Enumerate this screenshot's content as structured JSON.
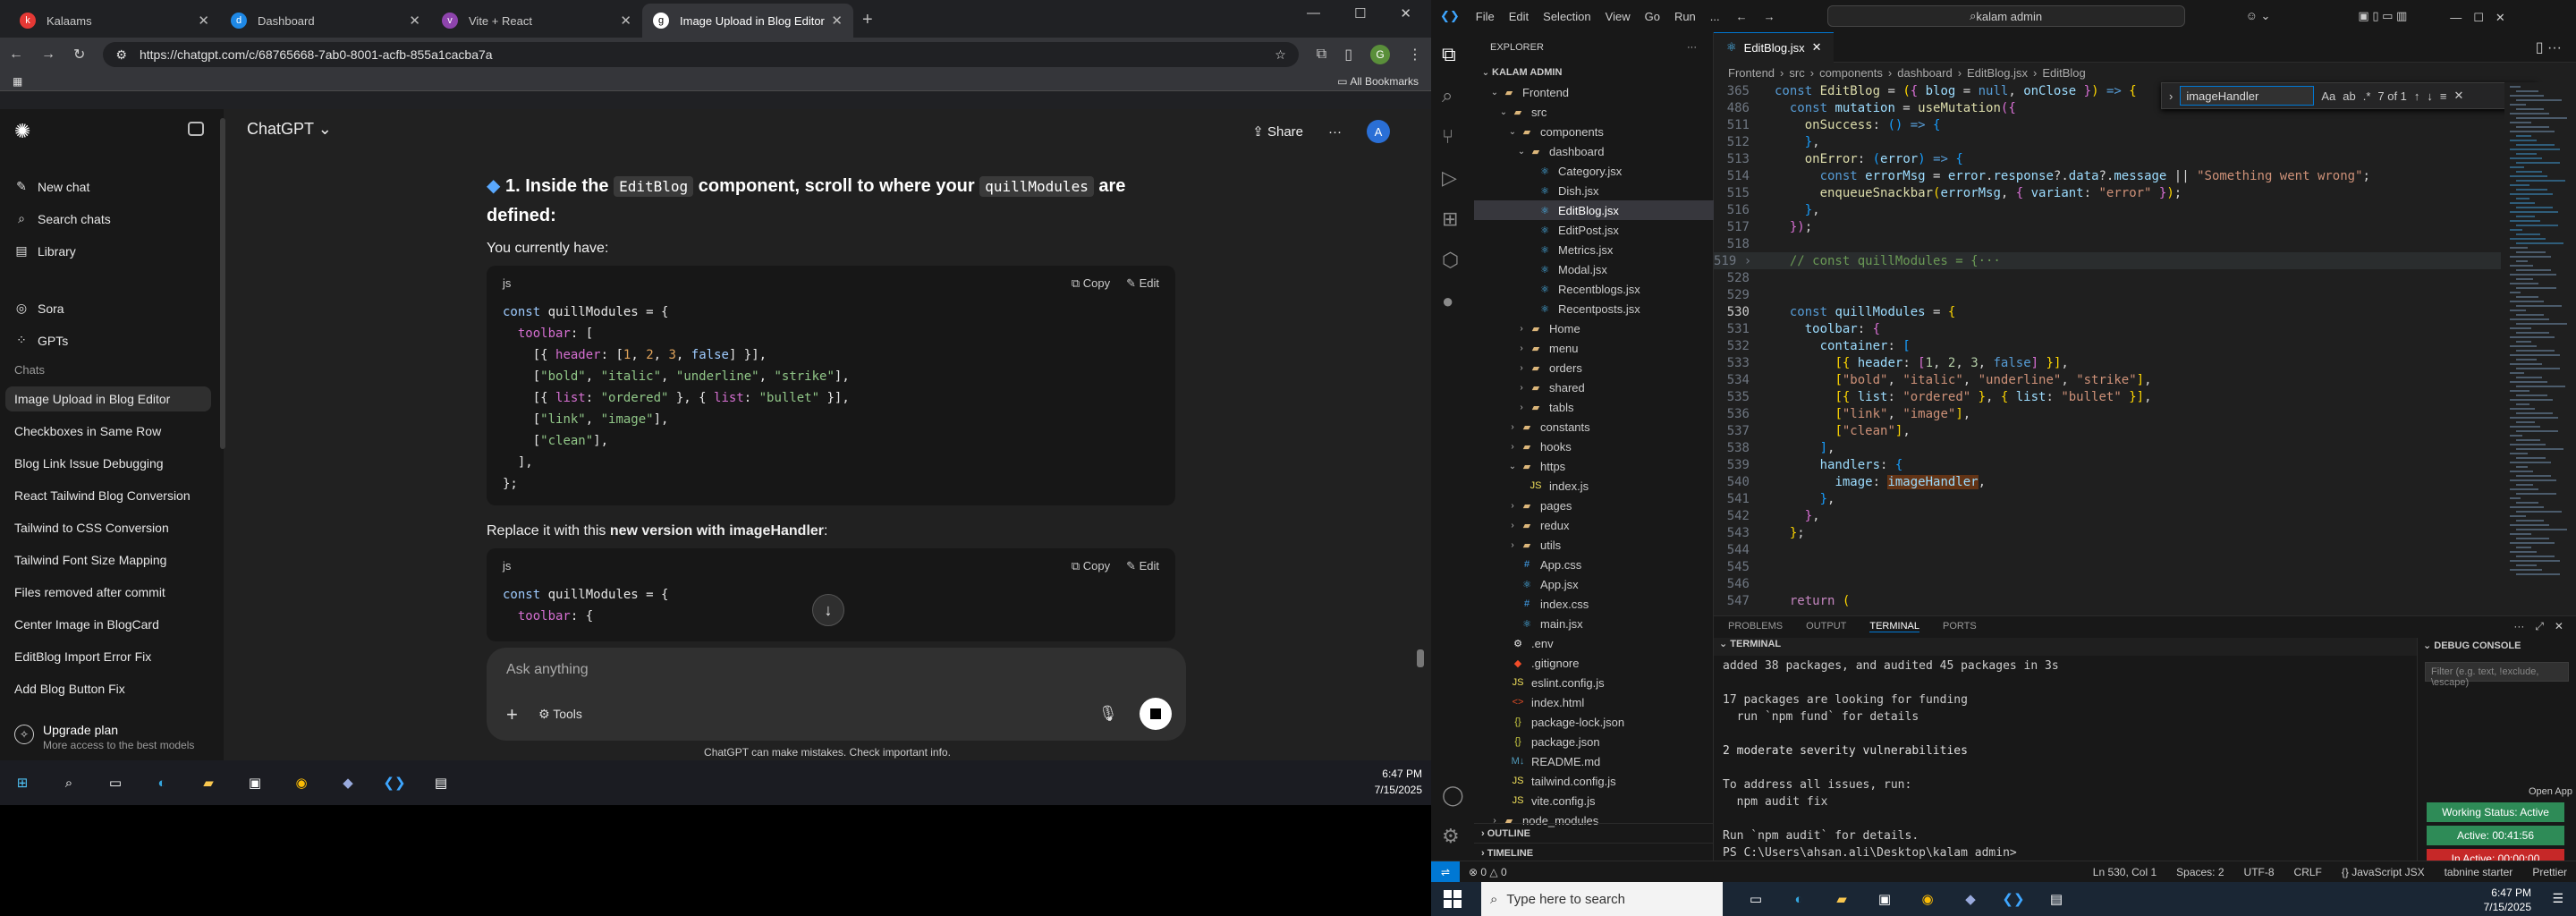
{
  "chrome": {
    "tabs": [
      {
        "label": "Kalaams",
        "icon": "k",
        "color": "#e53935"
      },
      {
        "label": "Dashboard",
        "icon": "d",
        "color": "#1e88e5"
      },
      {
        "label": "Vite + React",
        "icon": "v",
        "color": "#8e44ad"
      },
      {
        "label": "Image Upload in Blog Editor",
        "icon": "g",
        "color": "#ffffff"
      }
    ],
    "url": "https://chatgpt.com/c/68765668-7ab0-8001-acfb-855a1cacba7a",
    "bookmarks_label": "All Bookmarks",
    "profile_initial": "G"
  },
  "chatgpt": {
    "model": "ChatGPT",
    "share_label": "Share",
    "user_initial": "A",
    "sidebar": {
      "top_items": [
        {
          "label": "New chat",
          "icon": "edit-icon"
        },
        {
          "label": "Search chats",
          "icon": "search-icon"
        },
        {
          "label": "Library",
          "icon": "library-icon"
        }
      ],
      "mid_items": [
        {
          "label": "Sora",
          "icon": "sora-icon"
        },
        {
          "label": "GPTs",
          "icon": "gpts-icon"
        }
      ],
      "chats_heading": "Chats",
      "chats": [
        "Image Upload in Blog Editor",
        "Checkboxes in Same Row",
        "Blog Link Issue Debugging",
        "React Tailwind Blog Conversion",
        "Tailwind to CSS Conversion",
        "Tailwind Font Size Mapping",
        "Files removed after commit",
        "Center Image in BlogCard",
        "EditBlog Import Error Fix",
        "Add Blog Button Fix"
      ],
      "upgrade_title": "Upgrade plan",
      "upgrade_sub": "More access to the best models"
    },
    "message": {
      "step_prefix": "1. Inside the",
      "step_code1": "EditBlog",
      "step_mid": "component, scroll to where your",
      "step_code2": "quillModules",
      "step_suffix": "are defined:",
      "p1": "You currently have:",
      "p2_plain": "Replace it with this",
      "p2_bold": "new version with imageHandler",
      "p2_end": ":",
      "code_lang": "js",
      "copy_label": "Copy",
      "edit_label": "Edit"
    },
    "composer_placeholder": "Ask anything",
    "tools_label": "Tools",
    "disclaimer": "ChatGPT can make mistakes. Check important info."
  },
  "taskbar_left": {
    "time": "6:47 PM",
    "date": "7/15/2025"
  },
  "vscode": {
    "menu": [
      "File",
      "Edit",
      "Selection",
      "View",
      "Go",
      "Run",
      "..."
    ],
    "search": "kalam admin",
    "explorer_title": "EXPLORER",
    "root": "KALAM ADMIN",
    "tab": "EditBlog.jsx",
    "breadcrumb": [
      "Frontend",
      "src",
      "components",
      "dashboard",
      "EditBlog.jsx",
      "EditBlog"
    ],
    "find_text": "imageHandler",
    "find_count": "7 of 1",
    "tree": [
      {
        "d": 1,
        "t": "Frontend",
        "k": "folder",
        "o": "open"
      },
      {
        "d": 2,
        "t": "src",
        "k": "folder",
        "o": "open"
      },
      {
        "d": 3,
        "t": "components",
        "k": "folder",
        "o": "open"
      },
      {
        "d": 4,
        "t": "dashboard",
        "k": "folder",
        "o": "open"
      },
      {
        "d": 5,
        "t": "Category.jsx",
        "k": "jsx"
      },
      {
        "d": 5,
        "t": "Dish.jsx",
        "k": "jsx"
      },
      {
        "d": 5,
        "t": "EditBlog.jsx",
        "k": "jsx",
        "sel": true
      },
      {
        "d": 5,
        "t": "EditPost.jsx",
        "k": "jsx"
      },
      {
        "d": 5,
        "t": "Metrics.jsx",
        "k": "jsx"
      },
      {
        "d": 5,
        "t": "Modal.jsx",
        "k": "jsx"
      },
      {
        "d": 5,
        "t": "Recentblogs.jsx",
        "k": "jsx"
      },
      {
        "d": 5,
        "t": "Recentposts.jsx",
        "k": "jsx"
      },
      {
        "d": 4,
        "t": "Home",
        "k": "folder",
        "o": "closed"
      },
      {
        "d": 4,
        "t": "menu",
        "k": "folder",
        "o": "closed"
      },
      {
        "d": 4,
        "t": "orders",
        "k": "folder",
        "o": "closed"
      },
      {
        "d": 4,
        "t": "shared",
        "k": "folder",
        "o": "closed"
      },
      {
        "d": 4,
        "t": "tabls",
        "k": "folder",
        "o": "closed"
      },
      {
        "d": 3,
        "t": "constants",
        "k": "folder",
        "o": "closed"
      },
      {
        "d": 3,
        "t": "hooks",
        "k": "folder",
        "o": "closed"
      },
      {
        "d": 3,
        "t": "https",
        "k": "folder",
        "o": "open"
      },
      {
        "d": 4,
        "t": "index.js",
        "k": "js"
      },
      {
        "d": 3,
        "t": "pages",
        "k": "folder",
        "o": "closed"
      },
      {
        "d": 3,
        "t": "redux",
        "k": "folder",
        "o": "closed"
      },
      {
        "d": 3,
        "t": "utils",
        "k": "folder",
        "o": "closed"
      },
      {
        "d": 3,
        "t": "App.css",
        "k": "css"
      },
      {
        "d": 3,
        "t": "App.jsx",
        "k": "jsx"
      },
      {
        "d": 3,
        "t": "index.css",
        "k": "css"
      },
      {
        "d": 3,
        "t": "main.jsx",
        "k": "jsx"
      },
      {
        "d": 2,
        "t": ".env",
        "k": "env"
      },
      {
        "d": 2,
        "t": ".gitignore",
        "k": "git"
      },
      {
        "d": 2,
        "t": "eslint.config.js",
        "k": "js"
      },
      {
        "d": 2,
        "t": "index.html",
        "k": "html"
      },
      {
        "d": 2,
        "t": "package-lock.json",
        "k": "json"
      },
      {
        "d": 2,
        "t": "package.json",
        "k": "json"
      },
      {
        "d": 2,
        "t": "README.md",
        "k": "md"
      },
      {
        "d": 2,
        "t": "tailwind.config.js",
        "k": "js"
      },
      {
        "d": 2,
        "t": "vite.config.js",
        "k": "js"
      },
      {
        "d": 1,
        "t": "node_modules",
        "k": "folder",
        "o": "closed"
      }
    ],
    "outline_label": "OUTLINE",
    "timeline_label": "TIMELINE",
    "panel_tabs": [
      "PROBLEMS",
      "OUTPUT",
      "TERMINAL",
      "PORTS"
    ],
    "terminal_title": "TERMINAL",
    "terminal_lines": [
      "added 38 packages, and audited 45 packages in 3s",
      "",
      "17 packages are looking for funding",
      "  run `npm fund` for details",
      "",
      "2 moderate severity vulnerabilities",
      "",
      "To address all issues, run:",
      "  npm audit fix",
      "",
      "Run `npm audit` for details.",
      "PS C:\\Users\\ahsan.ali\\Desktop\\kalam admin> "
    ],
    "debug_title": "DEBUG CONSOLE",
    "debug_filter": "Filter (e.g. text, !exclude, \\escape)",
    "open_app": "Open App",
    "working_status": "Working Status: Active",
    "active_time": "Active: 00:41:56",
    "inactive_time": "In Active: 00:00:00",
    "status_left": "⊗ 0 △ 0",
    "status_right": [
      "Ln 530, Col 1",
      "Spaces: 2",
      "UTF-8",
      "CRLF",
      "{} JavaScript JSX",
      "tabnine starter",
      "Prettier"
    ]
  },
  "taskbar_right": {
    "search_placeholder": "Type here to search",
    "time": "6:47 PM",
    "date": "7/15/2025"
  }
}
